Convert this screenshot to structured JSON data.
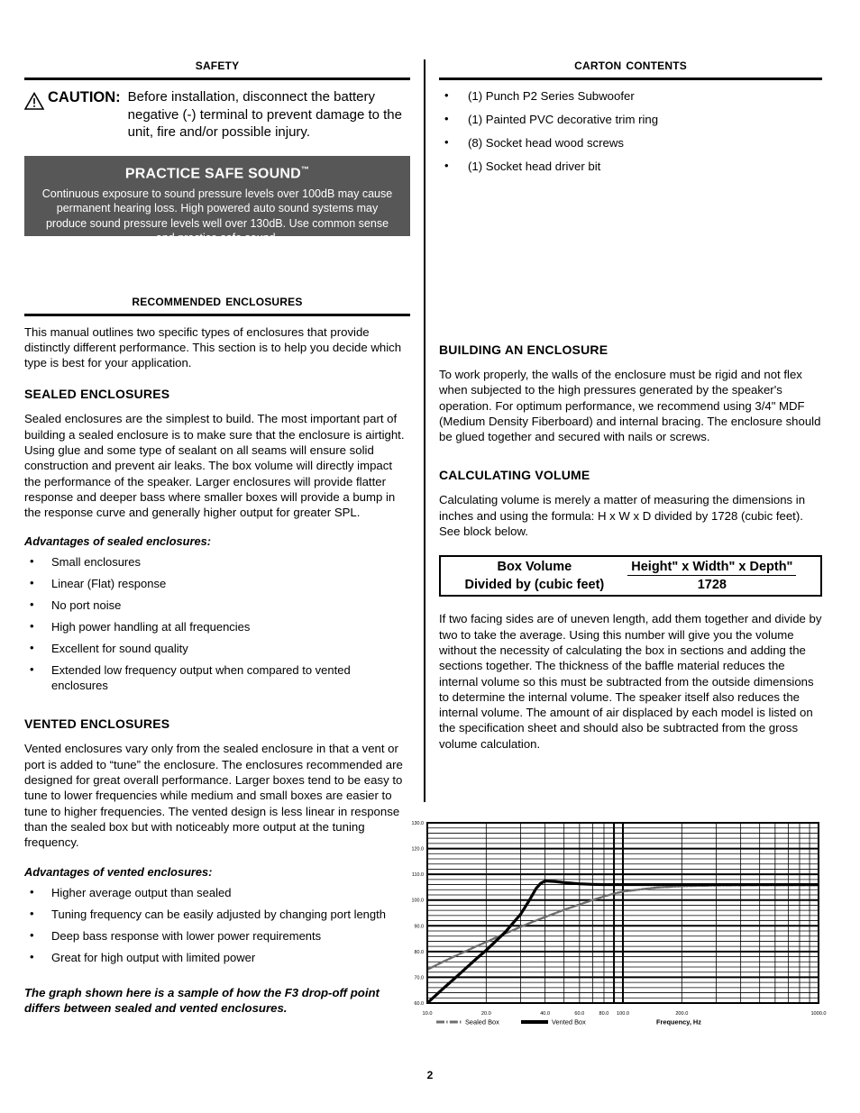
{
  "page": {
    "number": "2"
  },
  "safety": {
    "heading": "Safety",
    "caution_label": "CAUTION:",
    "caution_text": "Before installation, disconnect the battery negative (-) terminal to prevent damage to the unit, fire and/or possible injury.",
    "safe_sound_title": "PRACTICE SAFE SOUND",
    "safe_sound_tm": "™",
    "safe_sound_body": "Continuous exposure to sound pressure levels over 100dB may cause permanent hearing loss. High powered auto sound systems may produce sound pressure levels well over 130dB. Use common sense and practice safe sound."
  },
  "carton": {
    "heading": "Carton Contents",
    "items": [
      "(1) Punch P2 Series Subwoofer",
      "(1) Painted PVC decorative trim ring",
      "(8) Socket head wood screws",
      "(1) Socket head driver bit"
    ]
  },
  "recommended": {
    "heading": "Recommended Enclosures",
    "intro": "This manual outlines two specific types of enclosures that provide distinctly different performance. This section is to help you decide which type is best for your application.",
    "sealed": {
      "title": "SEALED ENCLOSURES",
      "body": "Sealed enclosures are the simplest to build. The most important part of building a sealed enclosure is to make sure that the enclosure is airtight. Using glue and some type of sealant on all seams will ensure solid construction and prevent air leaks. The box volume will directly impact the performance of the speaker. Larger enclosures will provide flatter response and deeper bass where smaller boxes will provide a bump in the response curve and generally higher output for greater SPL.",
      "advantages_label": "Advantages of sealed enclosures:",
      "advantages": [
        "Small enclosures",
        "Linear (Flat) response",
        "No port noise",
        "High power handling at all frequencies",
        "Excellent for sound quality",
        "Extended low frequency output when compared to vented enclosures"
      ]
    },
    "vented": {
      "title": "VENTED ENCLOSURES",
      "body": "Vented enclosures vary only from the sealed enclosure in that a vent or port is added to “tune” the enclosure. The enclosures recommended are designed for great overall performance. Larger boxes tend to be easy to tune to lower frequencies while medium and small boxes are easier to tune to higher frequencies. The vented design is less linear in response than the sealed box but with noticeably more output at the tuning frequency.",
      "advantages_label": "Advantages of vented enclosures:",
      "advantages": [
        "Higher average output than sealed",
        "Tuning frequency can be easily adjusted by changing port length",
        "Deep bass response with lower power requirements",
        "Great for high output with limited power"
      ]
    },
    "graph_note": "The graph shown here is a sample of how the F3 drop-off point differs between sealed and vented enclosures."
  },
  "building": {
    "title": "BUILDING AN ENCLOSURE",
    "body": "To work properly, the walls of the enclosure must be rigid and not flex when subjected to the high pressures generated by the speaker's operation. For optimum performance, we recommend using 3/4\" MDF (Medium Density Fiberboard) and internal bracing. The enclosure should be glued together and secured with nails or screws."
  },
  "calculating": {
    "title": "CALCULATING VOLUME",
    "body": "Calculating volume is merely a matter of measuring the dimensions in inches and using the formula:  H x W x D divided by 1728 (cubic feet). See block below.",
    "formula": {
      "left_line1": "Box Volume",
      "left_line2": "Divided by (cubic feet)",
      "numerator": "Height\" x Width\" x Depth\"",
      "numerator_plain": "Height x Width x Depth",
      "denominator": "1728"
    },
    "body2": "If two facing sides are of uneven length, add them together and divide by two to take the average. Using this number will give you the volume without the necessity of calculating the box in sections and adding the sections together. The thickness of the baffle material reduces the internal volume so this must be subtracted from the outside dimensions to determine the internal volume. The speaker itself also reduces the internal volume. The amount of air displaced by each model is listed on the specification sheet and should also be subtracted from the gross volume calculation."
  },
  "chart_data": {
    "type": "line",
    "title": "",
    "xlabel": "Frequency, Hz",
    "ylabel": "",
    "xscale": "log",
    "xlim": [
      10,
      1000
    ],
    "ylim": [
      60,
      130
    ],
    "yticks": [
      60.0,
      70.0,
      80.0,
      90.0,
      100.0,
      110.0,
      120.0,
      130.0
    ],
    "ytick_labels": [
      "60.0",
      "70.0",
      "80.0",
      "90.0",
      "100.0",
      "110.0",
      "120.0",
      "130.0"
    ],
    "xticks": [
      10,
      20,
      40,
      60,
      80,
      100,
      200,
      1000
    ],
    "xtick_labels": [
      "10.0",
      "20.0",
      "40.0",
      "60.0",
      "80.0",
      "100.0",
      "200.0",
      "1000.0"
    ],
    "grid": true,
    "legend_position": "below-left",
    "series": [
      {
        "name": "Sealed Box",
        "style": "dash-dot",
        "color": "#6e6e6e",
        "x": [
          10,
          12,
          14,
          16,
          18,
          20,
          25,
          30,
          35,
          40,
          50,
          60,
          70,
          80,
          90,
          100,
          150,
          200,
          300,
          500,
          700,
          1000
        ],
        "y": [
          73.0,
          76.0,
          78.4,
          80.4,
          82.2,
          83.7,
          87.0,
          89.6,
          91.7,
          93.4,
          96.2,
          98.3,
          100.0,
          101.4,
          102.5,
          103.3,
          104.9,
          105.4,
          105.7,
          105.8,
          105.8,
          105.8
        ]
      },
      {
        "name": "Vented Box",
        "style": "solid",
        "color": "#000000",
        "x": [
          10,
          12,
          14,
          16,
          18,
          20,
          25,
          30,
          33,
          36,
          38,
          40,
          45,
          50,
          60,
          70,
          80,
          90,
          100,
          150,
          200,
          300,
          500,
          700,
          1000
        ],
        "y": [
          60.0,
          65.5,
          70.0,
          74.0,
          77.5,
          80.5,
          87.5,
          94.5,
          99.5,
          104.5,
          106.5,
          107.4,
          107.2,
          106.8,
          106.3,
          106.1,
          106.0,
          106.0,
          106.0,
          106.0,
          106.0,
          106.0,
          106.0,
          106.0,
          106.0
        ]
      }
    ]
  }
}
